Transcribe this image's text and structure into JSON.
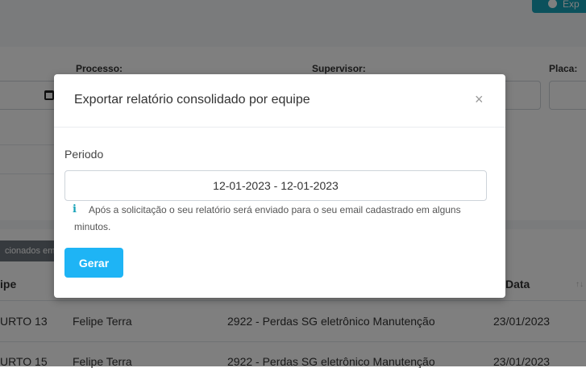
{
  "header": {
    "export_label": "Exp"
  },
  "filters": {
    "processo_label": "Processo:",
    "supervisor_label": "Supervisor:",
    "placa_label": "Placa:"
  },
  "table": {
    "selected_badge": "cionados em",
    "headers": {
      "equipe": "ipe",
      "data": "Data"
    },
    "rows": [
      {
        "equipe": "URTO 13",
        "nome": "Felipe Terra",
        "processo": "2922 - Perdas SG eletrônico Manutenção",
        "data": "23/01/2023"
      },
      {
        "equipe": "URTO 15",
        "nome": "Felipe Terra",
        "processo": "2922 - Perdas SG eletrônico Manutenção",
        "data": "23/01/2023"
      }
    ]
  },
  "modal": {
    "title": "Exportar relatório consolidado por equipe",
    "close": "×",
    "periodo_label": "Periodo",
    "periodo_value": "12-01-2023 - 12-01-2023",
    "info_icon": "i",
    "info_text": "Após a solicitação o seu relatório será enviado para o seu email cadastrado em alguns minutos.",
    "gerar_label": "Gerar"
  }
}
